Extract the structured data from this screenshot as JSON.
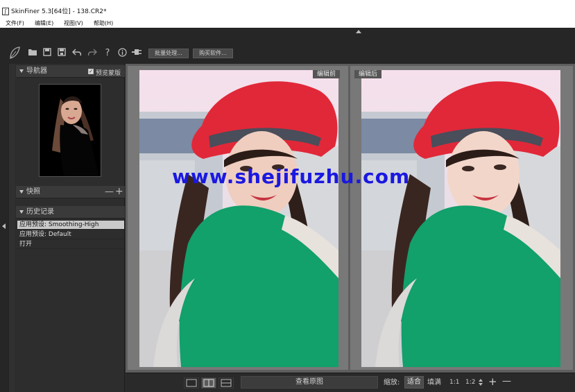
{
  "window": {
    "title": "SkinFiner 5.3[64位] - 138.CR2*",
    "icon": "app-logo-icon"
  },
  "menu": [
    {
      "label": "文件(F)"
    },
    {
      "label": "编辑(E)"
    },
    {
      "label": "视图(V)"
    },
    {
      "label": "帮助(H)"
    }
  ],
  "toolbar": {
    "icons": [
      "leaf-logo-icon",
      "open-folder-icon",
      "save-icon",
      "save-as-icon",
      "undo-icon",
      "redo-icon",
      "help-icon",
      "info-icon",
      "plugin-icon"
    ],
    "batch_label": "批量处理...",
    "buy_label": "购买软件..."
  },
  "navigator": {
    "title": "导航器",
    "preview_mask_label": "预览蒙版",
    "preview_mask_checked": true
  },
  "snapshots": {
    "title": "快照",
    "minus": "—",
    "plus": "+"
  },
  "history": {
    "title": "历史记录",
    "items": [
      {
        "label": "应用预设: Smoothing-High",
        "selected": true
      },
      {
        "label": "应用预设: Default",
        "selected": false
      },
      {
        "label": "打开",
        "selected": false
      }
    ]
  },
  "canvas": {
    "before_label": "编辑前",
    "after_label": "编辑后",
    "watermark": "www.shejifuzhu.com"
  },
  "bottombar": {
    "layouts": [
      "single-view-icon",
      "side-by-side-icon",
      "stacked-view-icon"
    ],
    "active_layout": 1,
    "view_original": "查看原图",
    "zoom_label": "缩放:",
    "fit": "适合",
    "fill": "填满",
    "one_to_one": "1:1",
    "one_to_two": "1:2",
    "spinner": "spinner-icon",
    "zoom_in": "+",
    "zoom_out": "—"
  },
  "colors": {
    "hat": "#e02a3c",
    "scarf": "#14a06a",
    "background": "#262626",
    "watermark": "#1a18e0"
  }
}
